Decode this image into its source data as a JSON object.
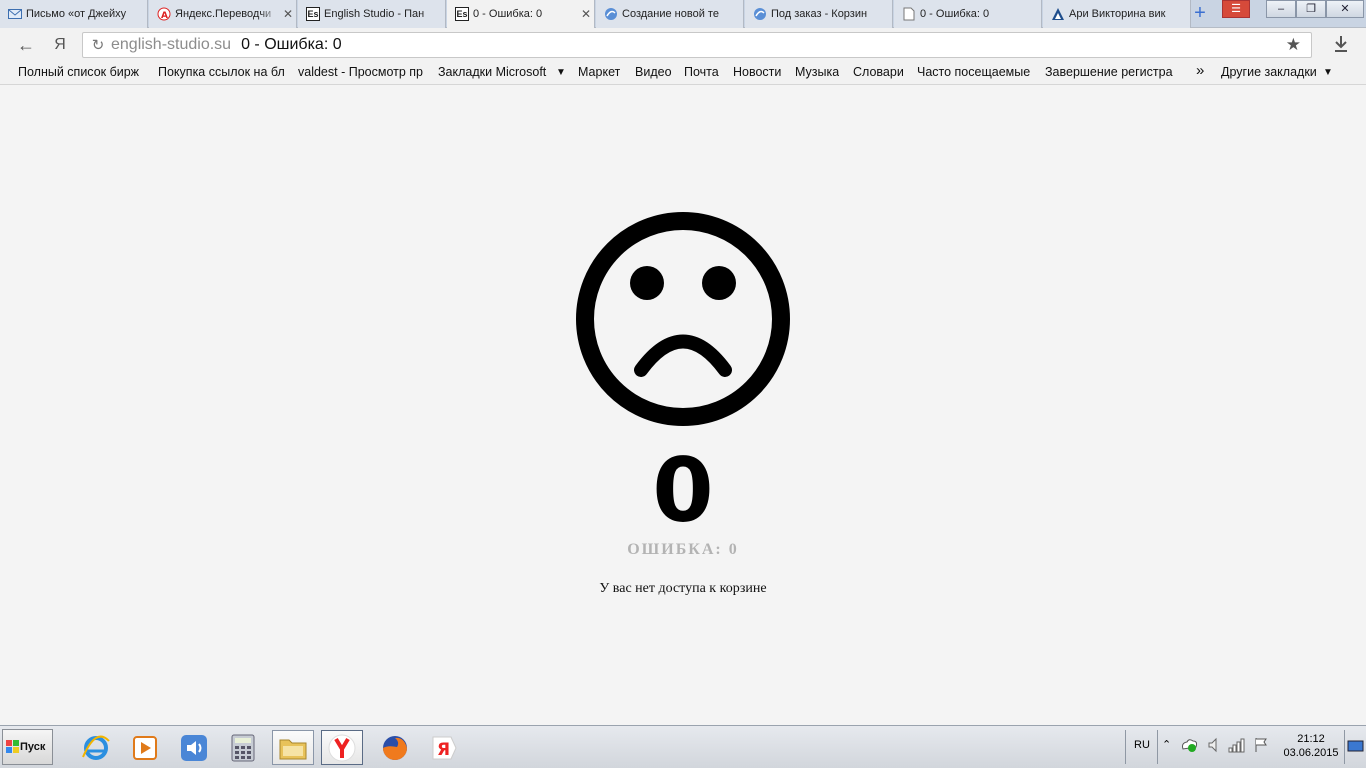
{
  "tabs": [
    {
      "title": "Письмо «от Джейху",
      "icon": "mail-icon",
      "closable": false,
      "active": false
    },
    {
      "title": "Яндекс.Переводчи",
      "icon": "yandex-translate-icon",
      "closable": true,
      "active": false
    },
    {
      "title": "English Studio - Пан",
      "icon": "english-studio-icon",
      "closable": false,
      "active": false
    },
    {
      "title": "0 - Ошибка: 0",
      "icon": "english-studio-icon",
      "closable": true,
      "active": true
    },
    {
      "title": "Создание новой те",
      "icon": "forum-icon",
      "closable": false,
      "active": false
    },
    {
      "title": "Под заказ - Корзин",
      "icon": "forum-icon",
      "closable": false,
      "active": false
    },
    {
      "title": "0 - Ошибка: 0",
      "icon": "page-icon",
      "closable": false,
      "active": false
    },
    {
      "title": "Ари Викторина вик",
      "icon": "triangle-icon",
      "closable": false,
      "active": false
    }
  ],
  "address": {
    "host": "english-studio.su",
    "title": "0 - Ошибка: 0"
  },
  "bookmarks": {
    "items": [
      "Полный список бирж",
      "Покупка ссылок на бл",
      "valdest - Просмотр пр",
      "Закладки Microsoft",
      "Маркет",
      "Видео",
      "Почта",
      "Новости",
      "Музыка",
      "Словари",
      "Часто посещаемые",
      "Завершение регистра"
    ],
    "overflow": "»",
    "other": "Другие закладки"
  },
  "error": {
    "code": "0",
    "label": "ОШИБКА: 0",
    "message": "У вас нет доступа к корзине"
  },
  "taskbar": {
    "start_label": "Пуск",
    "lang": "RU",
    "time": "21:12",
    "date": "03.06.2015",
    "apps": [
      "ie-icon",
      "media-player-icon",
      "volume-app-icon",
      "calculator-icon",
      "file-explorer-icon",
      "yandex-browser-icon",
      "firefox-icon",
      "yandex-icon"
    ]
  },
  "colors": {
    "page_bg": "#f4f4f4",
    "error_label": "#b3b3b3"
  }
}
